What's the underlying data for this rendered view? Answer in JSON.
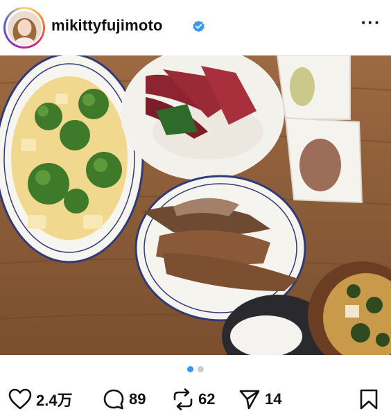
{
  "post": {
    "username": "mikittyfujimoto",
    "verified": true,
    "more_icon": "more-horizontal-icon",
    "more_label": "···"
  },
  "carousel": {
    "total": 2,
    "active_index": 0,
    "accent": "#3897f0"
  },
  "actions": {
    "likes": "2.4万",
    "comments": "89",
    "reposts": "62",
    "shares": "14"
  },
  "colors": {
    "verified": "#3897f0",
    "text": "#111111"
  }
}
